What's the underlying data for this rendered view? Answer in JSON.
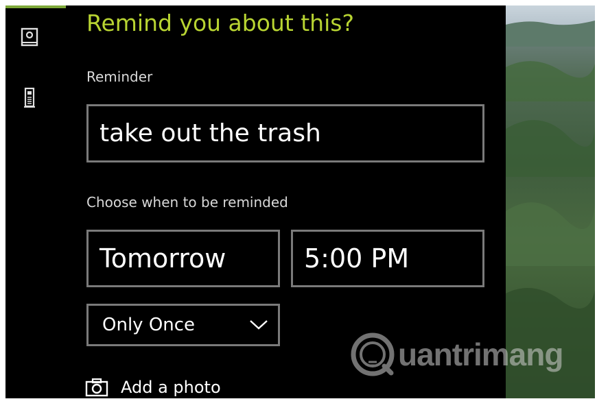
{
  "dialog": {
    "title": "Remind you about this?",
    "title_color": "#b8d432"
  },
  "sidebar": {
    "accent_color": "#7ea93a",
    "icons": [
      "notebook-icon",
      "device-icon"
    ]
  },
  "reminder": {
    "label": "Reminder",
    "value": "take out the trash"
  },
  "schedule": {
    "label": "Choose when to be reminded",
    "date_value": "Tomorrow",
    "time_value": "5:00 PM",
    "repeat_value": "Only Once"
  },
  "photo": {
    "label": "Add a photo"
  },
  "watermark": {
    "text": "uantrimang"
  }
}
